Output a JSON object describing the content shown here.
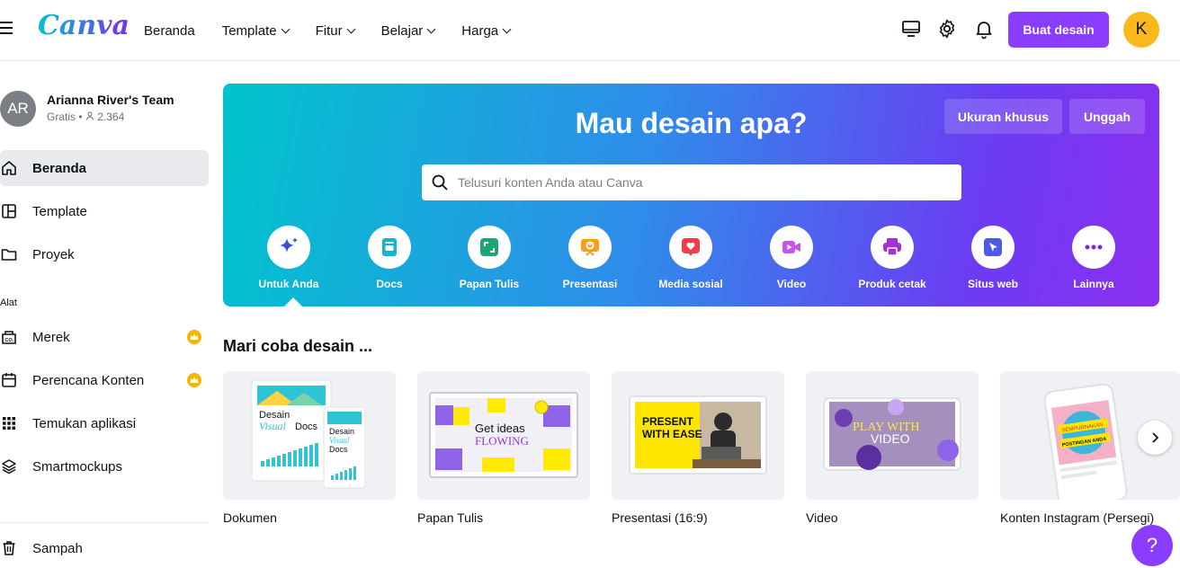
{
  "header": {
    "logo": "Canva",
    "nav": [
      {
        "label": "Beranda",
        "dropdown": false
      },
      {
        "label": "Template",
        "dropdown": true
      },
      {
        "label": "Fitur",
        "dropdown": true
      },
      {
        "label": "Belajar",
        "dropdown": true
      },
      {
        "label": "Harga",
        "dropdown": true
      }
    ],
    "create_label": "Buat desain",
    "avatar_initial": "K",
    "icons": [
      "desktop-icon",
      "gear-icon",
      "bell-icon"
    ]
  },
  "sidebar": {
    "team_initials": "AR",
    "team_name": "Arianna River's Team",
    "team_plan": "Gratis",
    "team_members": "2.364",
    "items": [
      {
        "label": "Beranda",
        "icon": "home-icon"
      },
      {
        "label": "Template",
        "icon": "template-icon"
      },
      {
        "label": "Proyek",
        "icon": "folder-icon"
      }
    ],
    "tools_heading": "Alat",
    "tools": [
      {
        "label": "Merek",
        "icon": "brand-icon",
        "premium": true
      },
      {
        "label": "Perencana Konten",
        "icon": "calendar-icon",
        "premium": true
      },
      {
        "label": "Temukan aplikasi",
        "icon": "apps-grid-icon",
        "premium": false
      },
      {
        "label": "Smartmockups",
        "icon": "layers-icon",
        "premium": false
      }
    ],
    "trash_label": "Sampah"
  },
  "hero": {
    "title": "Mau desain apa?",
    "custom_size_label": "Ukuran khusus",
    "upload_label": "Unggah",
    "search_placeholder": "Telusuri konten Anda atau Canva",
    "categories": [
      {
        "label": "Untuk Anda",
        "icon": "sparkle-icon",
        "color": "#3d4bd8"
      },
      {
        "label": "Docs",
        "icon": "docs-icon",
        "color": "#12b5cb"
      },
      {
        "label": "Papan Tulis",
        "icon": "whiteboard-icon",
        "color": "#1ea672"
      },
      {
        "label": "Presentasi",
        "icon": "presentation-icon",
        "color": "#ff9c1b"
      },
      {
        "label": "Media sosial",
        "icon": "heart-icon",
        "color": "#ee3e4a"
      },
      {
        "label": "Video",
        "icon": "video-icon",
        "color": "#c556e8"
      },
      {
        "label": "Produk cetak",
        "icon": "print-icon",
        "color": "#a52fd6"
      },
      {
        "label": "Situs web",
        "icon": "cursor-icon",
        "color": "#4c5ae6"
      },
      {
        "label": "Lainnya",
        "icon": "more-icon",
        "color": "#7d2ae8"
      }
    ]
  },
  "try_section": {
    "title": "Mari coba desain ...",
    "cards": [
      {
        "label": "Dokumen",
        "thumb_text_1": "Desain",
        "thumb_text_2": "Visual",
        "thumb_text_3": "Docs",
        "thumb_small_1": "Desain",
        "thumb_small_2": "Visual",
        "thumb_small_3": "Docs"
      },
      {
        "label": "Papan Tulis",
        "thumb_text_1": "Get ideas",
        "thumb_text_2": "FLOWING"
      },
      {
        "label": "Presentasi (16:9)",
        "thumb_text_1": "PRESENT",
        "thumb_text_2": "WITH EASE"
      },
      {
        "label": "Video",
        "thumb_text_1": "PLAY WITH",
        "thumb_text_2": "VIDEO"
      },
      {
        "label": "Konten Instagram (Persegi)",
        "thumb_text_1": "SEMPURNAKAN",
        "thumb_text_2": "POSTINGAN ANDA"
      }
    ]
  },
  "help_label": "?",
  "colors": {
    "accent": "#8b3dff",
    "avatar": "#f9b91d",
    "crown": "#f8b600"
  }
}
